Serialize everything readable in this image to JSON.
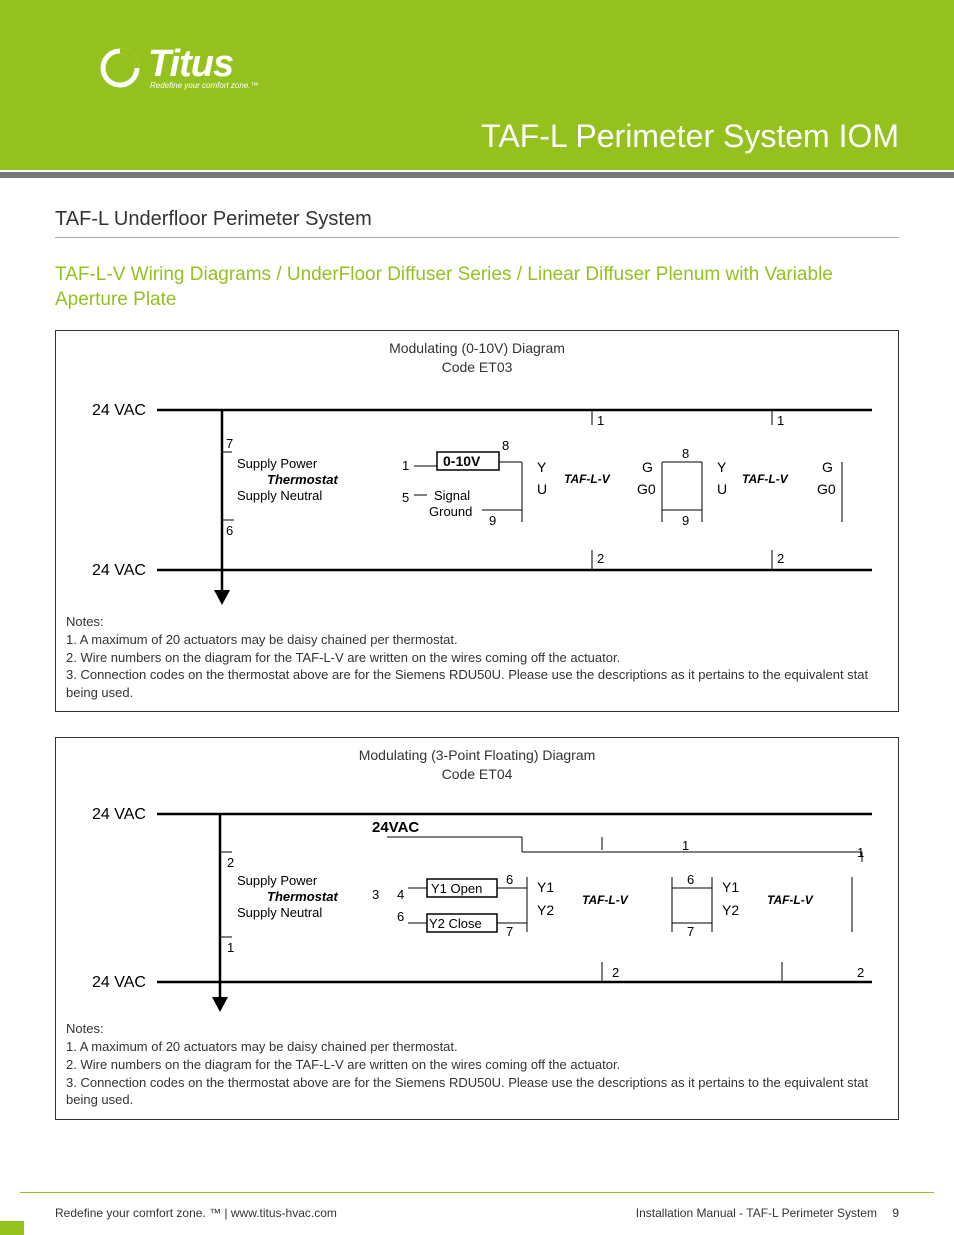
{
  "brand": {
    "name": "Titus",
    "tagline": "Redefine your comfort zone.™"
  },
  "doc_title": "TAF-L Perimeter System IOM",
  "section_title": "TAF-L Underfloor Perimeter System",
  "subheading": "TAF-L-V Wiring Diagrams / UnderFloor Diffuser Series / Linear Diffuser Plenum with Variable Aperture Plate",
  "diagram1": {
    "title_line1": "Modulating (0-10V) Diagram",
    "title_line2": "Code ET03",
    "labels": {
      "rail_top": "24 VAC",
      "rail_bottom": "24 VAC",
      "supply_power": "Supply Power",
      "thermostat": "Thermostat",
      "supply_neutral": "Supply Neutral",
      "zero_ten": "0-10V",
      "signal": "Signal",
      "ground": "Ground",
      "module": "TAF-L-V",
      "Y": "Y",
      "U": "U",
      "G": "G",
      "G0": "G0",
      "n1": "1",
      "n2": "2",
      "n5": "5",
      "n6": "6",
      "n7": "7",
      "n8": "8",
      "n9": "9"
    },
    "notes_label": "Notes:",
    "notes": [
      "1.  A maximum of 20 actuators may be daisy chained per thermostat.",
      "2.  Wire numbers on the diagram for the TAF-L-V are written on the wires coming off the actuator.",
      "3.  Connection codes on the thermostat above are for the Siemens RDU50U. Please use the descriptions as it pertains to the equivalent stat being used."
    ]
  },
  "diagram2": {
    "title_line1": "Modulating (3-Point Floating) Diagram",
    "title_line2": "Code ET04",
    "labels": {
      "rail_top": "24 VAC",
      "rail_bottom": "24 VAC",
      "vac24": "24VAC",
      "supply_power": "Supply Power",
      "thermostat": "Thermostat",
      "supply_neutral": "Supply Neutral",
      "y1open": "Y1 Open",
      "y2close": "Y2 Close",
      "module": "TAF-L-V",
      "Y1": "Y1",
      "Y2": "Y2",
      "n1": "1",
      "n2": "2",
      "n3": "3",
      "n4": "4",
      "n6": "6",
      "n7": "7"
    },
    "notes_label": "Notes:",
    "notes": [
      "1.  A maximum of 20 actuators may be daisy chained per thermostat.",
      "2.  Wire numbers on the diagram for the TAF-L-V are written on the wires coming off the actuator.",
      "3.  Connection codes on the thermostat above are for the Siemens RDU50U. Please use the descriptions as it pertains to the equivalent stat being used."
    ]
  },
  "footer": {
    "left": "Redefine your comfort zone. ™ | www.titus-hvac.com",
    "right": "Installation Manual - TAF-L Perimeter System",
    "page": "9"
  }
}
